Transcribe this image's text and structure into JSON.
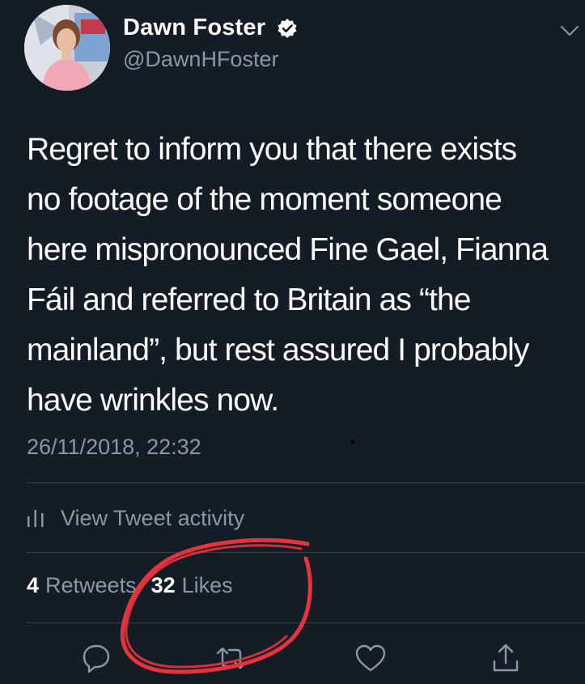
{
  "author": {
    "display_name": "Dawn Foster",
    "handle": "@DawnHFoster",
    "verified": true
  },
  "tweet": {
    "text": "Regret to inform you that there exists\nno footage of the moment someone\nhere mispronounced Fine Gael, Fianna\nFáil and referred to Britain as “the\nmainland”, but rest assured I probably\nhave wrinkles now.",
    "timestamp": "26/11/2018, 22:32"
  },
  "activity": {
    "label": "View Tweet activity"
  },
  "stats": {
    "retweets_count": "4",
    "retweets_label": "Retweets",
    "likes_count": "32",
    "likes_label": "Likes"
  },
  "actions": [
    "reply-icon",
    "retweet-icon",
    "like-icon",
    "share-icon"
  ],
  "colors": {
    "background": "#141d26",
    "text_primary": "#ffffff",
    "text_secondary": "#8899a6",
    "divider": "#38444d",
    "scribble": "#e8333d"
  }
}
